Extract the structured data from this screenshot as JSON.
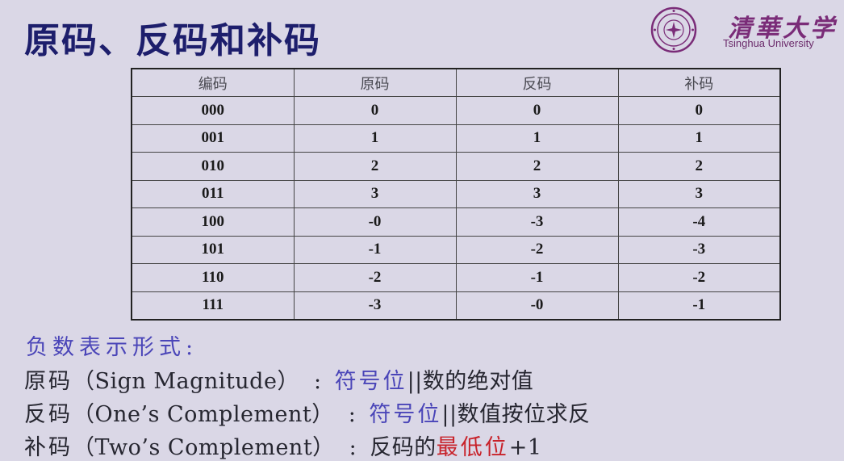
{
  "title": "原码、反码和补码",
  "logo": {
    "cn_text": "清華大学",
    "en_text": "Tsinghua University"
  },
  "table": {
    "headers": [
      "编码",
      "原码",
      "反码",
      "补码"
    ],
    "rows": [
      [
        "000",
        "0",
        "0",
        "0"
      ],
      [
        "001",
        "1",
        "1",
        "1"
      ],
      [
        "010",
        "2",
        "2",
        "2"
      ],
      [
        "011",
        "3",
        "3",
        "3"
      ],
      [
        "100",
        "-0",
        "-3",
        "-4"
      ],
      [
        "101",
        "-1",
        "-2",
        "-3"
      ],
      [
        "110",
        "-2",
        "-1",
        "-2"
      ],
      [
        "111",
        "-3",
        "-0",
        "-1"
      ]
    ]
  },
  "negatives": {
    "heading": "负数表示形式:",
    "lines": [
      {
        "term": "原码",
        "english": "（Sign Magnitude）",
        "colon": ":",
        "blue": "符号位",
        "rest": "||数的绝对值",
        "red": "",
        "tail": ""
      },
      {
        "term": "反码",
        "english": "（One’s Complement）",
        "colon": ":",
        "blue": "符号位",
        "rest": "||数值按位求反",
        "red": "",
        "tail": ""
      },
      {
        "term": "补码",
        "english": "（Two’s Complement）",
        "colon": ":",
        "blue": "",
        "rest": "反码的",
        "red": "最低位",
        "tail": "+1"
      }
    ]
  },
  "colors": {
    "title": "#1d1e6c",
    "accent_blue": "#4a45b8",
    "accent_red": "#c8222a",
    "background": "#dad7e6",
    "logo_purple": "#7a2c78"
  }
}
